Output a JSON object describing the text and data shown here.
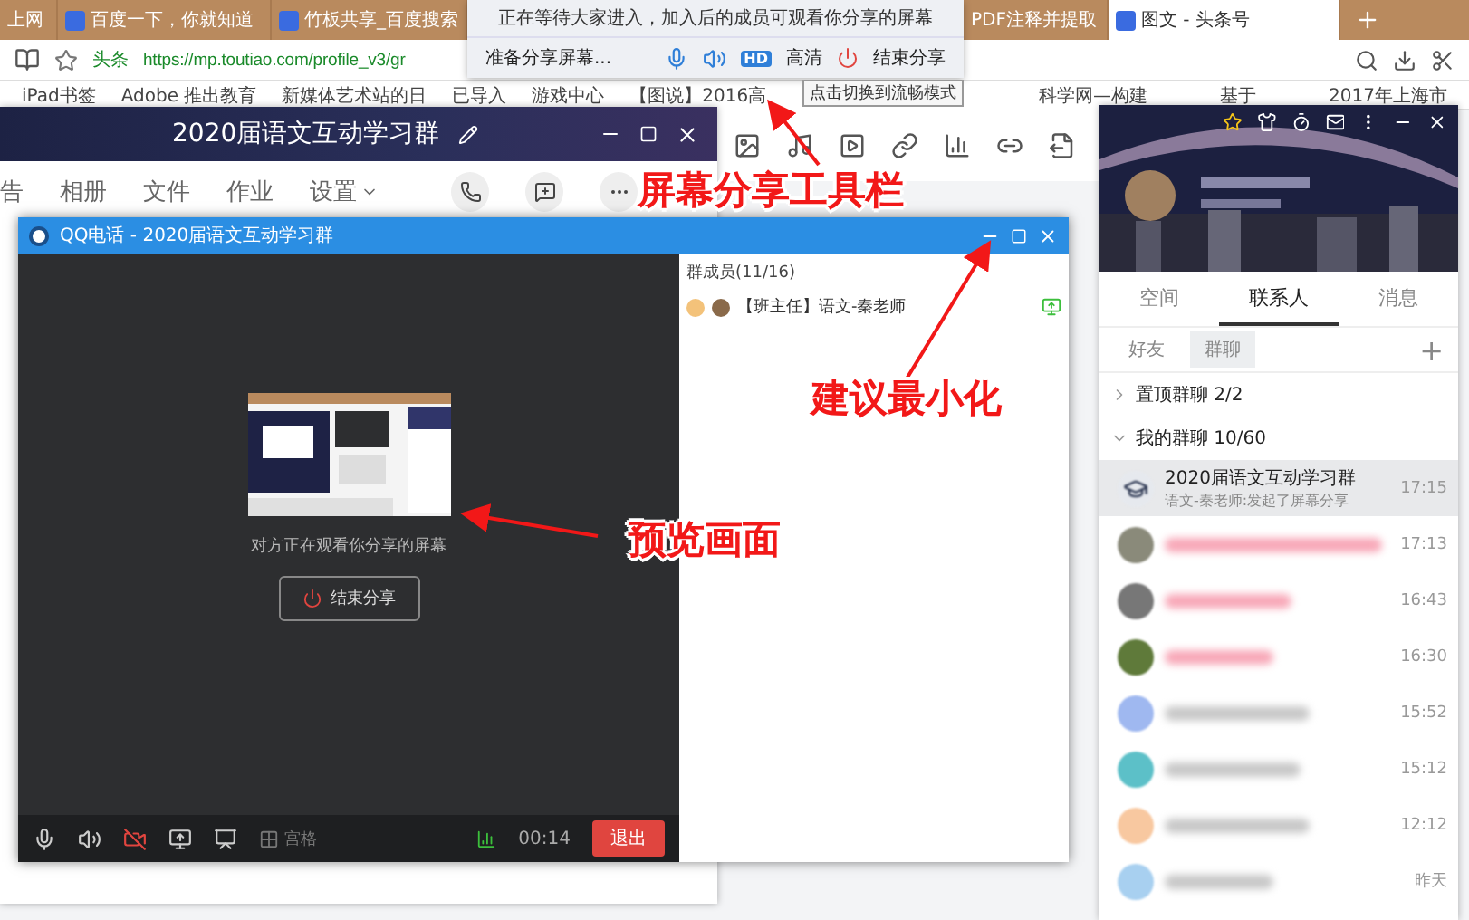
{
  "browser": {
    "tabs": [
      {
        "label": "上网",
        "selected": false
      },
      {
        "label": "百度一下，你就知道",
        "selected": false
      },
      {
        "label": "竹板共享_百度搜索",
        "selected": false
      },
      {
        "label": "PDF注释并提取",
        "selected": false
      },
      {
        "label": "图文 - 头条号",
        "selected": true
      }
    ],
    "address": {
      "site": "头条",
      "url": "https://mp.toutiao.com/profile_v3/gr"
    },
    "bookmarks": [
      "iPad书签",
      "Adobe 推出教育",
      "新媒体艺术站的日",
      "已导入",
      "游戏中心",
      "【图说】2016高",
      "科学网—构建",
      "基于",
      "2017年上海市"
    ]
  },
  "share_toolbar": {
    "status": "正在等待大家进入，加入后的成员可观看你分享的屏幕",
    "state": "准备分享屏幕...",
    "quality_badge": "HD",
    "quality": "高清",
    "stop": "结束分享",
    "tooltip": "点击切换到流畅模式"
  },
  "group_window": {
    "title": "2020届语文互动学习群",
    "tabs": [
      "告",
      "相册",
      "文件",
      "作业",
      "设置"
    ]
  },
  "call_window": {
    "title": "QQ电话 - 2020届语文互动学习群",
    "preview_caption": "对方正在观看你分享的屏幕",
    "stop_button": "结束分享",
    "members_header": "群成员(11/16)",
    "members": [
      {
        "name": "【班主任】语文-秦老师"
      }
    ],
    "grid_label": "宫格",
    "timer": "00:14",
    "exit": "退出"
  },
  "contacts_panel": {
    "tabs": [
      {
        "label": "空间",
        "selected": false
      },
      {
        "label": "联系人",
        "selected": true
      },
      {
        "label": "消息",
        "selected": false
      }
    ],
    "subtabs": [
      {
        "label": "好友",
        "selected": false
      },
      {
        "label": "群聊",
        "selected": true
      }
    ],
    "add": "+",
    "groups": [
      {
        "label": "置顶群聊",
        "count": "2/2",
        "expanded": false
      },
      {
        "label": "我的群聊",
        "count": "10/60",
        "expanded": true
      }
    ],
    "chats": [
      {
        "kind": "group",
        "name": "2020届语文互动学习群",
        "preview": "语文-秦老师:发起了屏幕分享",
        "time": "17:15",
        "selected": true,
        "color": "#e6e9ee"
      },
      {
        "kind": "blurred",
        "time": "17:13",
        "selected": false,
        "color": "#8a8a7a"
      },
      {
        "kind": "blurred",
        "time": "16:43",
        "selected": false,
        "color": "#777777"
      },
      {
        "kind": "blurred",
        "time": "16:30",
        "selected": false,
        "color": "#5f7a3a"
      },
      {
        "kind": "blurred",
        "time": "15:52",
        "selected": false,
        "color": "#9fb8f0"
      },
      {
        "kind": "blurred",
        "time": "15:12",
        "selected": false,
        "color": "#5cc0c8"
      },
      {
        "kind": "blurred",
        "time": "12:12",
        "selected": false,
        "color": "#f8c8a0"
      },
      {
        "kind": "blurred",
        "time": "昨天",
        "selected": false,
        "color": "#a8d0f0"
      }
    ]
  },
  "annotations": [
    {
      "text": "屏幕分享工具栏"
    },
    {
      "text": "建议最小化"
    },
    {
      "text": "预览画面"
    }
  ]
}
